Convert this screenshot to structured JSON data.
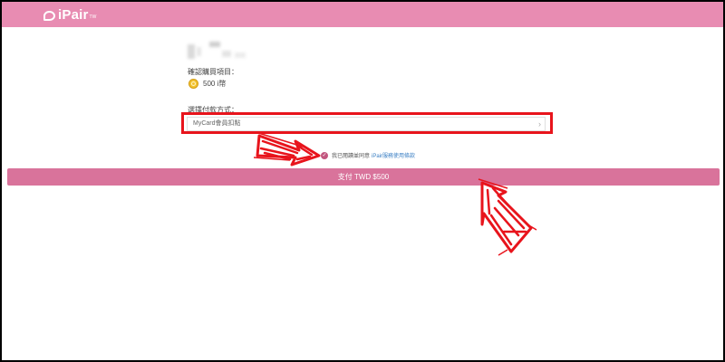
{
  "header": {
    "logo_text": "iPair",
    "logo_sub": "TW",
    "bar_color": "#e88cb2"
  },
  "purchase": {
    "confirm_label": "確認購買項目：",
    "item_amount": "500 i幣",
    "item_icon": "coin-icon"
  },
  "payment": {
    "method_label": "選擇付款方式：",
    "selected_method": "MyCard會員扣點",
    "chevron": "›"
  },
  "agreement": {
    "check_icon": "✓",
    "text": "我已閱讀並同意",
    "link_text": "iPair服務使用條款"
  },
  "pay_button": {
    "label": "支付 TWD $500",
    "color": "#d9739b"
  },
  "annotations": {
    "highlight_color": "#e8141c",
    "arrow_color": "#e8141c"
  }
}
